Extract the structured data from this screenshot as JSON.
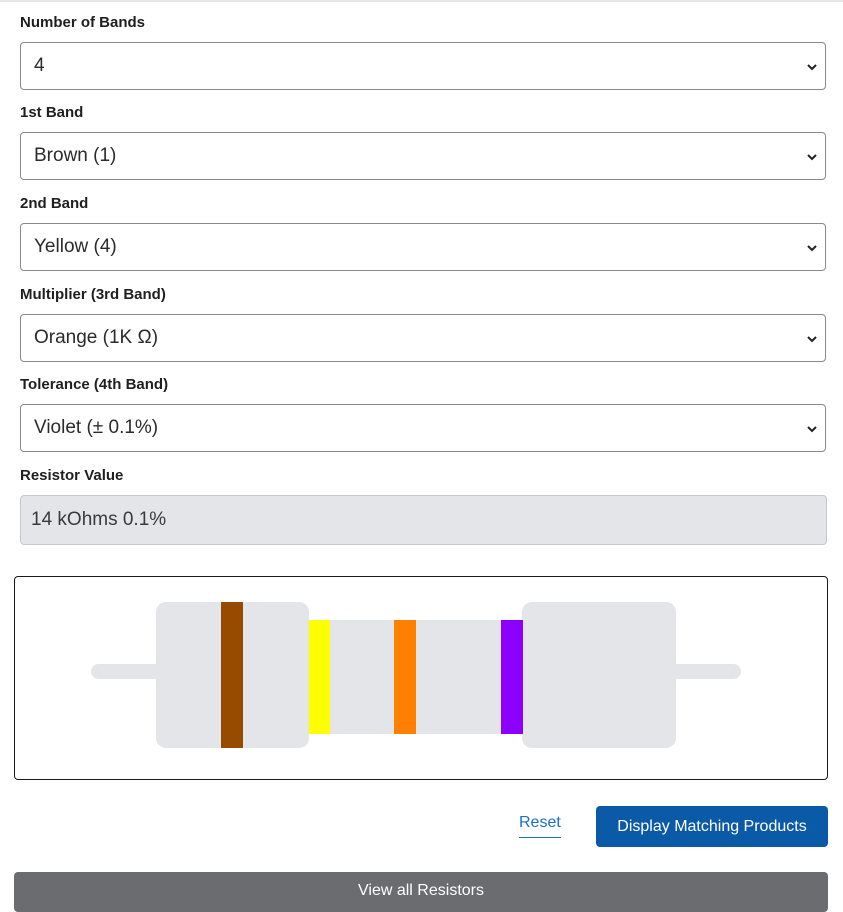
{
  "form": {
    "bands": {
      "label": "Number of Bands",
      "value": "4"
    },
    "band1": {
      "label": "1st Band",
      "value": "Brown (1)",
      "color": "#964b00"
    },
    "band2": {
      "label": "2nd Band",
      "value": "Yellow (4)",
      "color": "#ffff00"
    },
    "multiplier": {
      "label": "Multiplier (3rd Band)",
      "value": "Orange (1K Ω)",
      "color": "#ff8000"
    },
    "tolerance": {
      "label": "Tolerance (4th Band)",
      "value": "Violet (± 0.1%)",
      "color": "#8b00ff"
    },
    "result": {
      "label": "Resistor Value",
      "value": "14 kOhms 0.1%"
    }
  },
  "resistor": {
    "body_color": "#e3e5e9"
  },
  "actions": {
    "reset_label": "Reset",
    "display_label": "Display Matching Products",
    "view_all_label": "View all Resistors"
  },
  "icons": {
    "select_arrow": "chevron-down-icon"
  }
}
